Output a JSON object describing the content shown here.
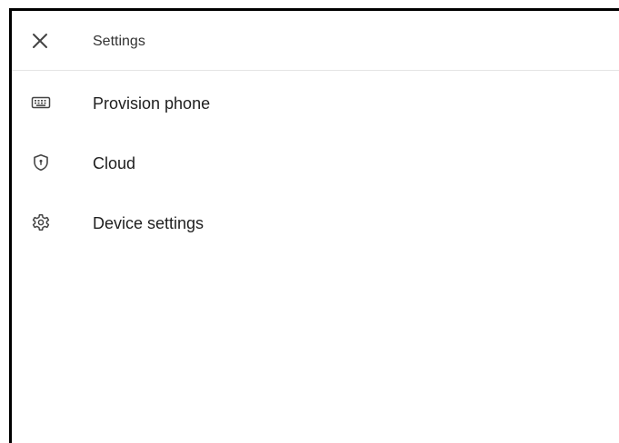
{
  "header": {
    "title": "Settings",
    "close_icon": "close-icon"
  },
  "menu": {
    "items": [
      {
        "label": "Provision phone",
        "icon": "keyboard-icon"
      },
      {
        "label": "Cloud",
        "icon": "shield-icon"
      },
      {
        "label": "Device settings",
        "icon": "gear-icon"
      }
    ]
  },
  "colors": {
    "text": "#1f1f1f",
    "icon": "#444444",
    "divider": "#e4e4e4",
    "frame_border": "#000000",
    "background": "#ffffff"
  }
}
